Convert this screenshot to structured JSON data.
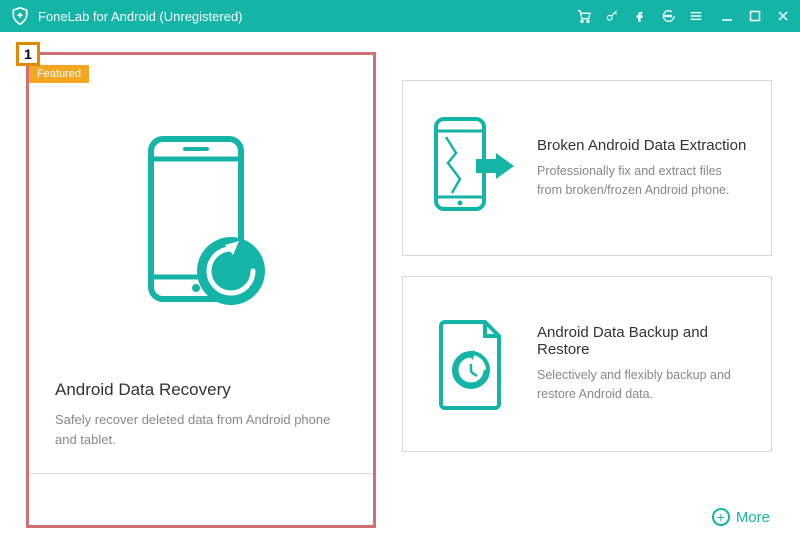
{
  "titlebar": {
    "title": "FoneLab for Android (Unregistered)"
  },
  "step_badge": "1",
  "featured_label": "Featured",
  "cards": {
    "recovery": {
      "title": "Android Data Recovery",
      "desc": "Safely recover deleted data from Android phone and tablet."
    },
    "extraction": {
      "title": "Broken Android Data Extraction",
      "desc": "Professionally fix and extract files from broken/frozen Android phone."
    },
    "backup": {
      "title": "Android Data Backup and Restore",
      "desc": "Selectively and flexibly backup and restore Android data."
    }
  },
  "more_label": "More",
  "colors": {
    "accent": "#14b5a6",
    "featured": "#f5a623",
    "highlight": "#d07070"
  }
}
